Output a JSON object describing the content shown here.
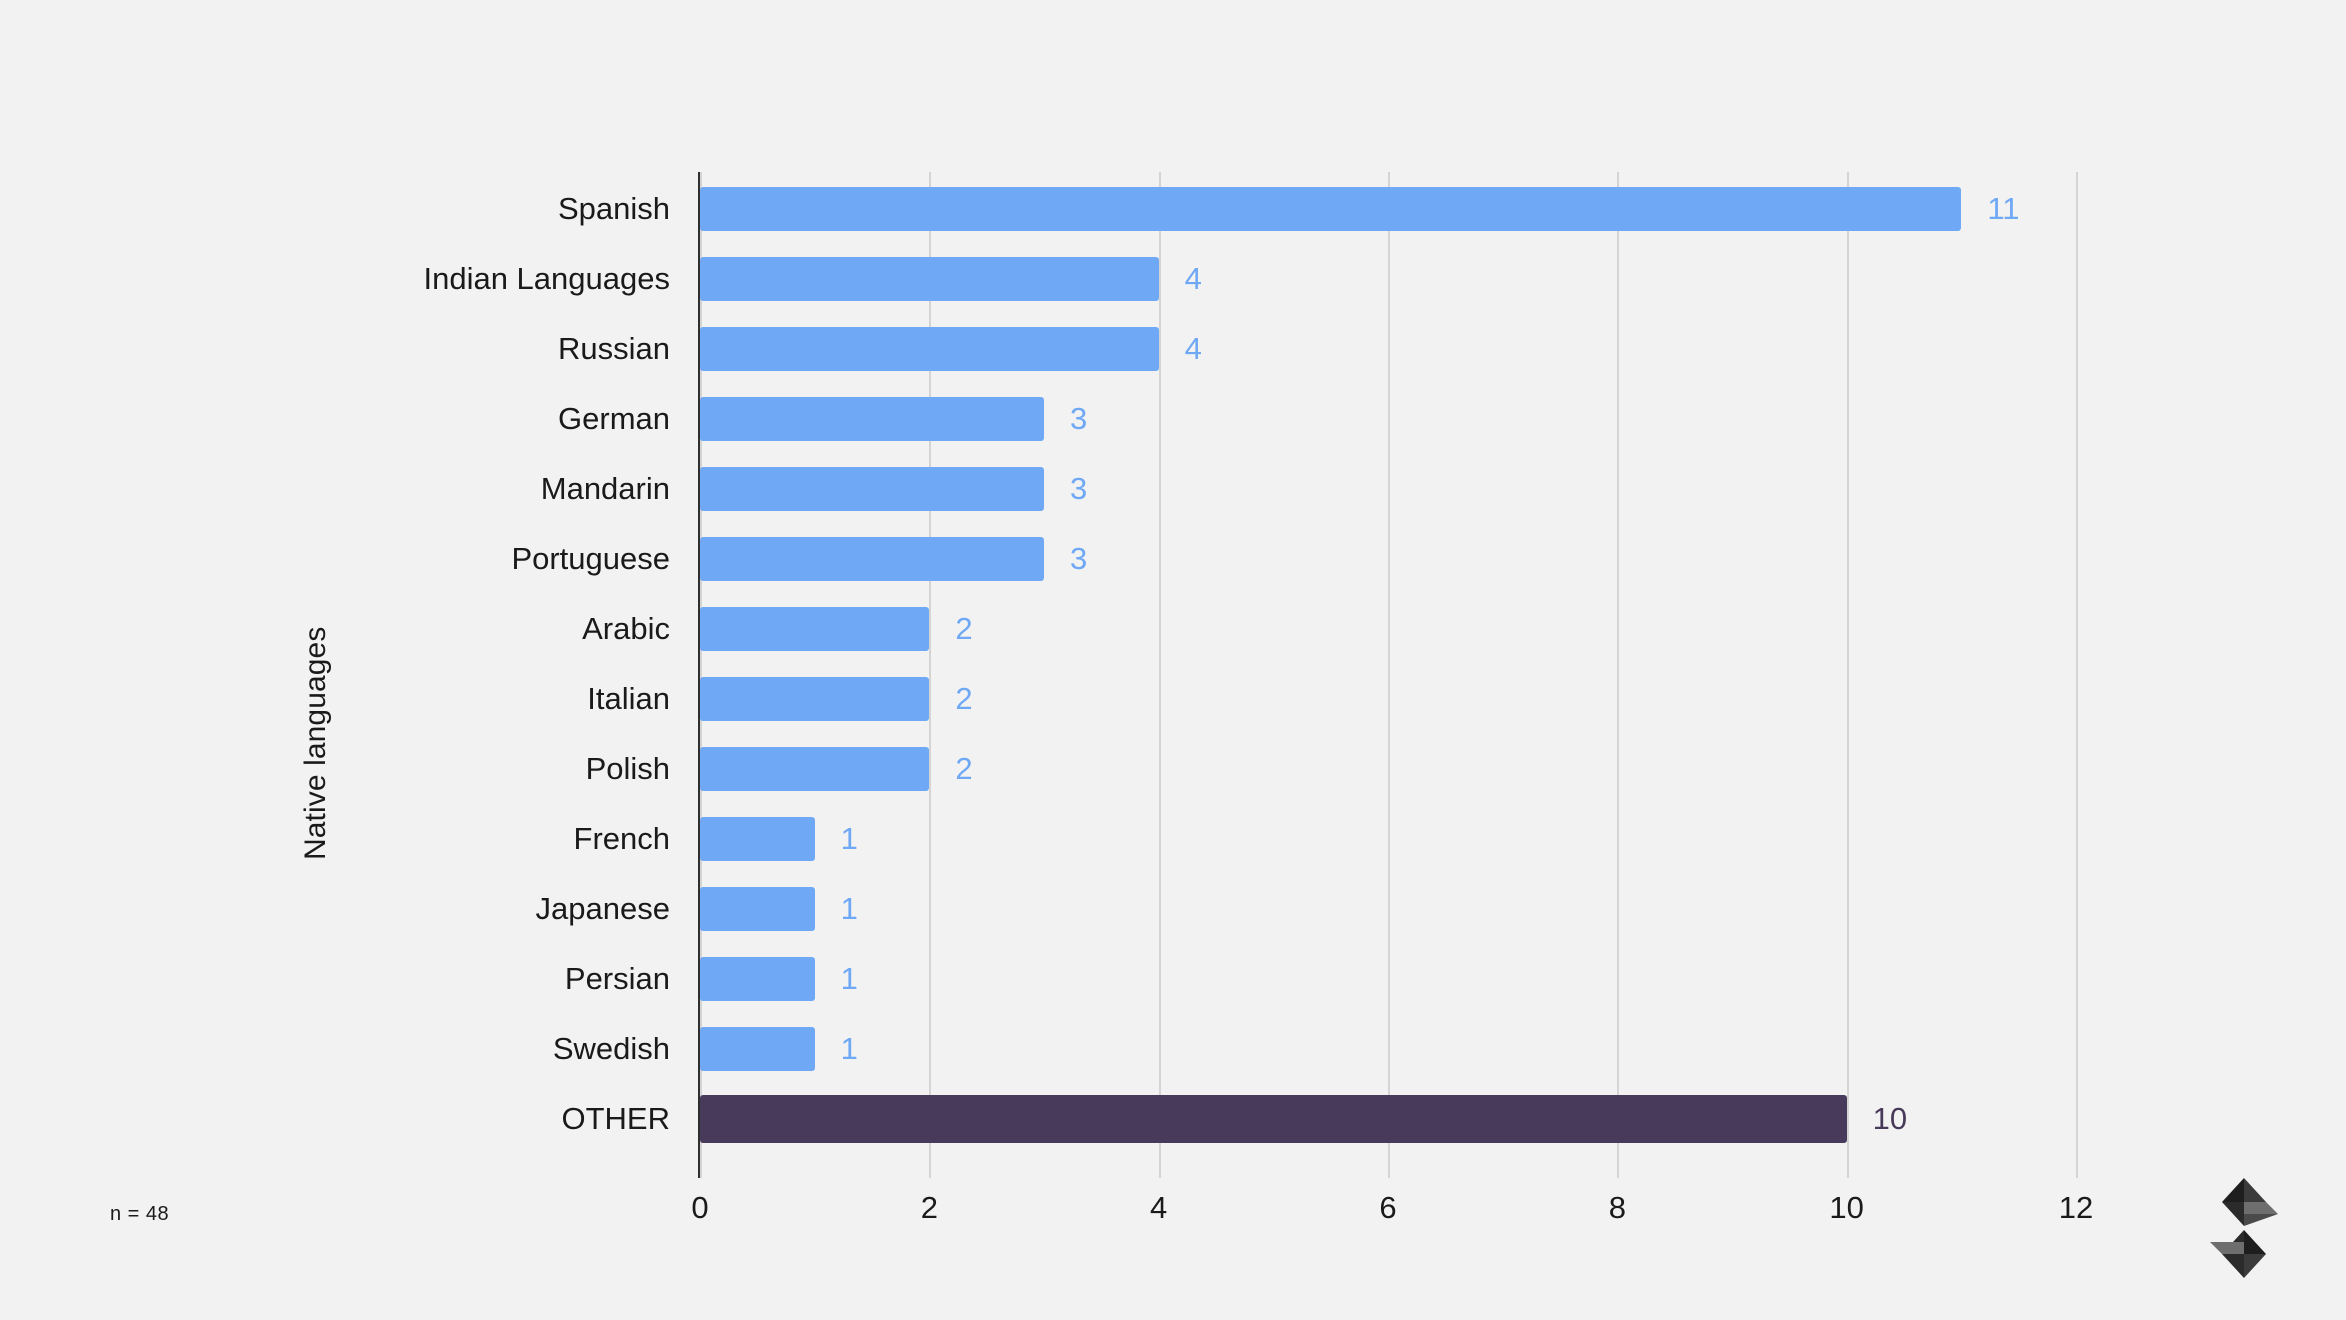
{
  "chart_data": {
    "type": "bar",
    "orientation": "horizontal",
    "title": "",
    "xlabel": "",
    "ylabel": "Native languages",
    "xlim": [
      0,
      12
    ],
    "xticks": [
      "0",
      "2",
      "4",
      "6",
      "8",
      "10",
      "12"
    ],
    "grid": "vertical",
    "legend": "none",
    "categories": [
      "Spanish",
      "Indian Languages",
      "Russian",
      "German",
      "Mandarin",
      "Portuguese",
      "Arabic",
      "Italian",
      "Polish",
      "French",
      "Japanese",
      "Persian",
      "Swedish",
      "OTHER"
    ],
    "values": [
      11,
      4,
      4,
      3,
      3,
      3,
      2,
      2,
      2,
      1,
      1,
      1,
      1,
      10
    ],
    "value_labels": [
      "11",
      "4",
      "4",
      "3",
      "3",
      "3",
      "2",
      "2",
      "2",
      "1",
      "1",
      "1",
      "1",
      "10"
    ],
    "bar_colors": [
      "#6fa8f5",
      "#6fa8f5",
      "#6fa8f5",
      "#6fa8f5",
      "#6fa8f5",
      "#6fa8f5",
      "#6fa8f5",
      "#6fa8f5",
      "#6fa8f5",
      "#6fa8f5",
      "#6fa8f5",
      "#6fa8f5",
      "#6fa8f5",
      "#483a5a"
    ],
    "annotations": [
      "n = 48"
    ]
  },
  "axes": {
    "y_title": "Native languages",
    "x_tick_labels": [
      "0",
      "2",
      "4",
      "6",
      "8",
      "10",
      "12"
    ]
  },
  "footnote": {
    "sample_size": "n = 48"
  },
  "colors": {
    "background": "#f2f2f2",
    "bar_primary": "#6fa8f5",
    "bar_other": "#483a5a",
    "gridline": "#d4d4d4",
    "axis_spine": "#2f2f2f",
    "text": "#1a1a1a"
  },
  "logo": {
    "name": "brand-logo"
  }
}
